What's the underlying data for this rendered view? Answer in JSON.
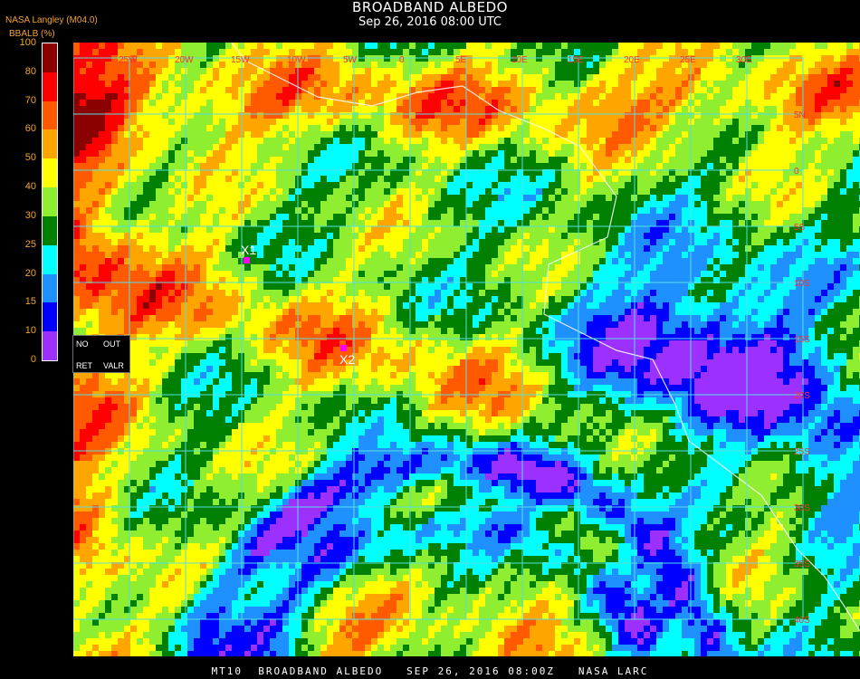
{
  "header": {
    "title": "BROADBAND ALBEDO",
    "subtitle": "Sep 26, 2016 08:00 UTC",
    "source": "NASA Langley (M04.0)",
    "units": "BBALB (%)"
  },
  "colorbar": {
    "ticks": [
      "100",
      "80",
      "70",
      "60",
      "50",
      "40",
      "30",
      "25",
      "20",
      "15",
      "10",
      "0"
    ],
    "colors": [
      "#8b0000",
      "#ff0000",
      "#ff5a00",
      "#ffa500",
      "#ffff00",
      "#90ee30",
      "#008000",
      "#00ffff",
      "#1e90ff",
      "#0000ff",
      "#9b30ff"
    ]
  },
  "legend": {
    "no_ret": "NO   OUT",
    "ret_valr": "RET  VALR",
    "no": "NO",
    "out": "OUT",
    "ret": "RET",
    "valr": "VALR"
  },
  "markers": [
    {
      "label": "X1"
    },
    {
      "label": "X2"
    }
  ],
  "grid_labels": {
    "longitudes": [
      "25W",
      "20W",
      "15W",
      "10W",
      "5W",
      "0",
      "5E",
      "10E",
      "15E",
      "20E",
      "25E",
      "30E"
    ],
    "latitudes": [
      "40S",
      "35S",
      "30S",
      "25S",
      "20S",
      "15S",
      "10S",
      "5S",
      "0",
      "5N"
    ]
  },
  "colors": {
    "grid": "#55e0e0",
    "label": "#f3a330",
    "coast": "#ffffff",
    "marker": "#ff00ff"
  },
  "footer": "MT10  BROADBAND ALBEDO   SEP 26, 2016 08:00Z   NASA LARC"
}
